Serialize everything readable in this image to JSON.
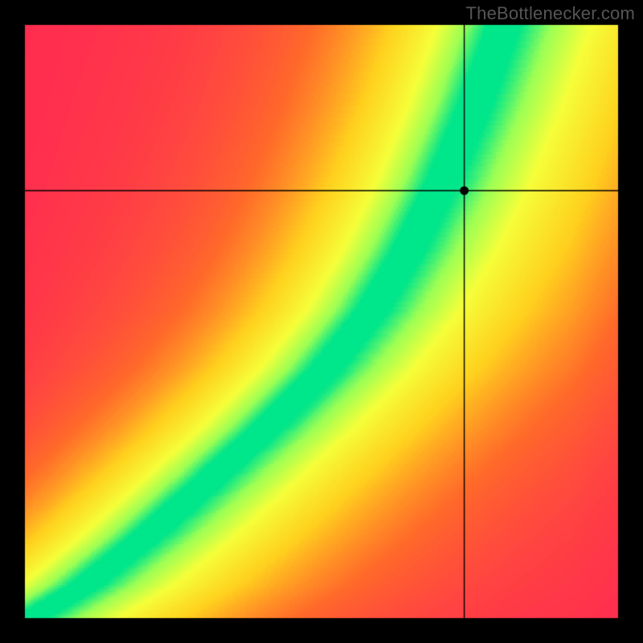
{
  "watermark": "TheBottlenecker.com",
  "chart_data": {
    "type": "heatmap",
    "title": "",
    "xlabel": "",
    "ylabel": "",
    "xlim": [
      0,
      1
    ],
    "ylim": [
      0,
      1
    ],
    "crosshair": {
      "x": 0.74,
      "y": 0.72
    },
    "marker": {
      "x": 0.74,
      "y": 0.72
    },
    "optimal_curve": [
      {
        "x": 0.0,
        "y": 0.0
      },
      {
        "x": 0.1,
        "y": 0.06
      },
      {
        "x": 0.2,
        "y": 0.14
      },
      {
        "x": 0.3,
        "y": 0.23
      },
      {
        "x": 0.4,
        "y": 0.32
      },
      {
        "x": 0.5,
        "y": 0.42
      },
      {
        "x": 0.58,
        "y": 0.52
      },
      {
        "x": 0.64,
        "y": 0.62
      },
      {
        "x": 0.7,
        "y": 0.74
      },
      {
        "x": 0.75,
        "y": 0.86
      },
      {
        "x": 0.8,
        "y": 1.0
      }
    ],
    "band_width": 0.06,
    "color_stops": [
      {
        "t": 0.0,
        "color": "#ff2a52"
      },
      {
        "t": 0.25,
        "color": "#ff6a2a"
      },
      {
        "t": 0.5,
        "color": "#ffd21e"
      },
      {
        "t": 0.72,
        "color": "#f6ff3a"
      },
      {
        "t": 0.88,
        "color": "#9bff55"
      },
      {
        "t": 1.0,
        "color": "#00e68c"
      }
    ],
    "frame": {
      "outer": 800,
      "inner_origin": 30,
      "inner_size": 740
    }
  }
}
